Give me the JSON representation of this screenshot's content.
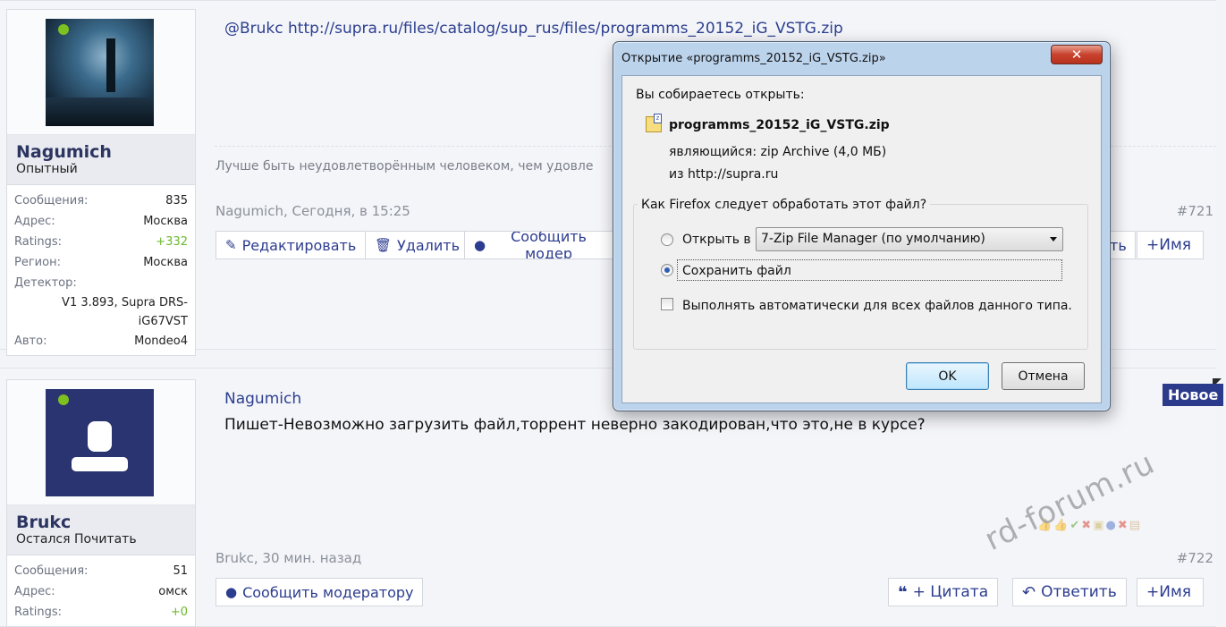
{
  "post1": {
    "user": {
      "name": "Nagumich",
      "title": "Опытный",
      "info": [
        {
          "label": "Сообщения:",
          "value": "835"
        },
        {
          "label": "Адрес:",
          "value": "Москва"
        },
        {
          "label": "Ratings:",
          "value": "+332"
        },
        {
          "label": "Регион:",
          "value": "Москва"
        }
      ],
      "detector_label": "Детектор:",
      "detector_value": "V1 3.893, Supra DRS-iG67VST",
      "auto_label": "Авто:",
      "auto_value": "Mondeo4"
    },
    "quote_link": "@Brukc http://supra.ru/files/catalog/sup_rus/files/programms_20152_iG_VSTG.zip",
    "signature": "Лучше быть неудовлетворённым человеком, чем удовле",
    "meta": "Nagumich, Сегодня, в 15:25",
    "num": "#721",
    "buttons": {
      "edit": "Редактировать",
      "delete": "Удалить",
      "report": "Сообщить модер",
      "reply_partial": "ть",
      "name": "+Имя"
    }
  },
  "post2": {
    "user": {
      "name": "Brukc",
      "title": "Остался Почитать",
      "info": [
        {
          "label": "Сообщения:",
          "value": "51"
        },
        {
          "label": "Адрес:",
          "value": "омск"
        },
        {
          "label": "Ratings:",
          "value": "+0"
        }
      ]
    },
    "author": "Nagumich",
    "text": "Пишет-Невозможно загрузить файл,торрент неверно закодирован,что это,не в курсе?",
    "meta": "Brukc, 30 мин. назад",
    "num": "#722",
    "badge": "Новое",
    "buttons": {
      "report": "Сообщить модератору",
      "quote": "+ Цитата",
      "reply": "Ответить",
      "name": "+Имя"
    }
  },
  "watermark": "rd-forum.ru",
  "dialog": {
    "title": "Открытие «programms_20152_iG_VSTG.zip»",
    "close": "✕",
    "intro": "Вы собираетесь открыть:",
    "filename": "programms_20152_iG_VSTG.zip",
    "type_label": "являющийся:",
    "type_value": "zip Archive (4,0 МБ)",
    "from_label": "из",
    "from_value": "http://supra.ru",
    "question": "Как Firefox следует обработать этот файл?",
    "open_with_label": "Открыть в",
    "open_with_value": "7-Zip File Manager (по умолчанию)",
    "save_label": "Сохранить файл",
    "auto_label": "Выполнять автоматически для всех файлов данного типа.",
    "ok": "OK",
    "cancel": "Отмена"
  }
}
